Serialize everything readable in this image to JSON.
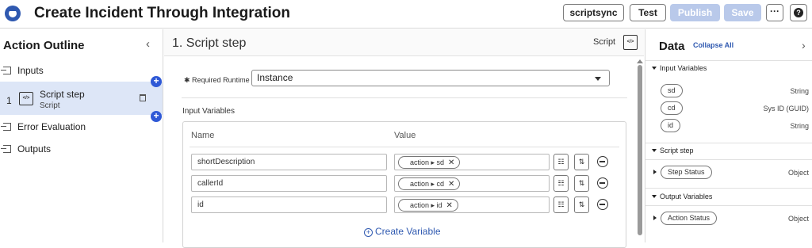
{
  "header": {
    "title": "Create Incident Through Integration",
    "buttons": {
      "scriptsync": "scriptsync",
      "test": "Test",
      "publish": "Publish",
      "save": "Save",
      "more": "···",
      "help": "?"
    }
  },
  "outline": {
    "title": "Action Outline",
    "collapse": "‹",
    "inputs": "Inputs",
    "step_number": "1",
    "step_name": "Script step",
    "step_type": "Script",
    "error_evaluation": "Error Evaluation",
    "outputs": "Outputs",
    "add_symbol": "+"
  },
  "main": {
    "step_title": "1.  Script step",
    "step_type": "Script",
    "required_runtime_label": "✱ Required Runtime",
    "runtime_value": "Instance",
    "input_variables_label": "Input Variables",
    "col_name": "Name",
    "col_value": "Value",
    "rows": [
      {
        "name": "shortDescription",
        "pill": "action ▸ sd"
      },
      {
        "name": "callerId",
        "pill": "action ▸ cd"
      },
      {
        "name": "id",
        "pill": "action ▸ id"
      }
    ],
    "create_variable": "Create Variable"
  },
  "data_panel": {
    "title": "Data",
    "collapse_all": "Collapse All",
    "chevron": "›",
    "input_variables_title": "Input Variables",
    "inputs": [
      {
        "name": "sd",
        "type": "String"
      },
      {
        "name": "cd",
        "type": "Sys ID (GUID)"
      },
      {
        "name": "id",
        "type": "String"
      }
    ],
    "script_step_title": "Script step",
    "step_status": {
      "name": "Step Status",
      "type": "Object"
    },
    "output_variables_title": "Output Variables",
    "action_status": {
      "name": "Action Status",
      "type": "Object"
    }
  }
}
